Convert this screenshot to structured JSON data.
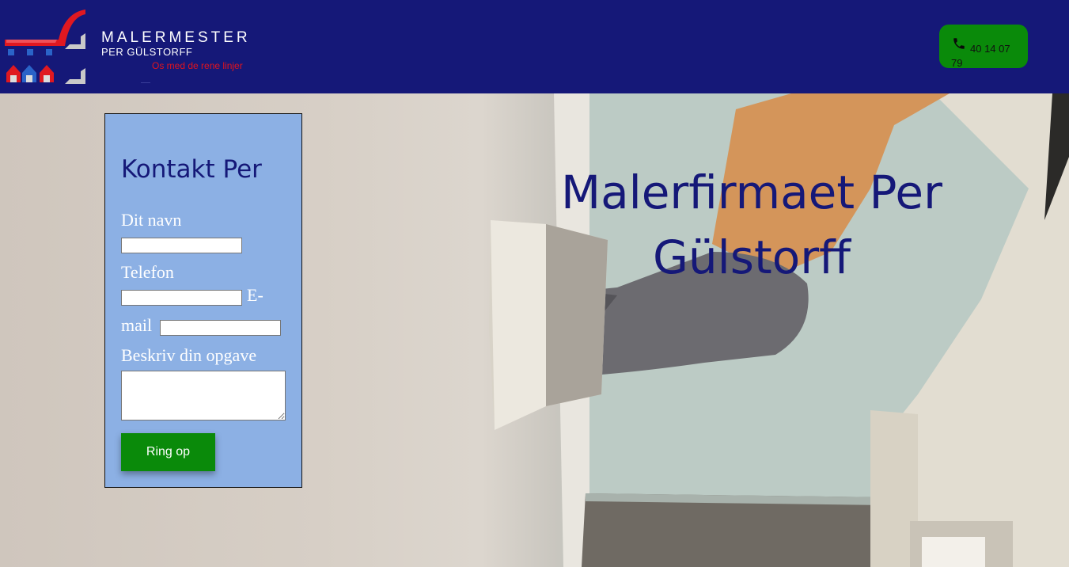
{
  "header": {
    "brand_title": "MALERMESTER",
    "brand_subtitle": "PER GÜLSTORFF",
    "tagline": "Os med de rene linjer",
    "phone_number": "40 14 07 79",
    "phone_icon": "phone-icon",
    "bg_color": "#151878",
    "phone_button_color": "#0a8a0a"
  },
  "hero": {
    "title": "Malerfirmaet Per Gülstorff"
  },
  "contact_form": {
    "title": "Kontakt Per",
    "name_label": "Dit navn",
    "name_value": "",
    "phone_label": "Telefon",
    "phone_value": "",
    "email_label_part1": "E-",
    "email_label_part2": "mail",
    "email_value": "",
    "task_label": "Beskriv din opgave",
    "task_value": "",
    "submit_label": "Ring op",
    "bg_color": "#8cb0e4"
  }
}
